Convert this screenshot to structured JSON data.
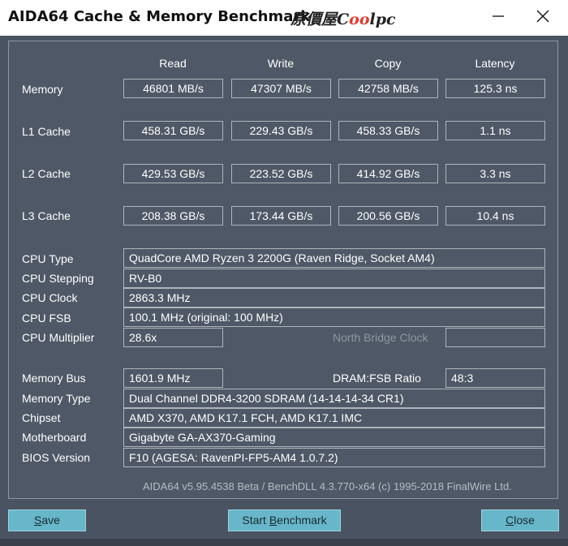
{
  "window": {
    "title": "AIDA64 Cache & Memory Benchmark",
    "logo_prefix": "原價屋C",
    "logo_o1": "o",
    "logo_o2": "o",
    "logo_suffix": "lpc",
    "logo_accent": "#e23a2c"
  },
  "columns": [
    "Read",
    "Write",
    "Copy",
    "Latency"
  ],
  "bench_rows": [
    {
      "label": "Memory",
      "values": [
        "46801 MB/s",
        "47307 MB/s",
        "42758 MB/s",
        "125.3 ns"
      ]
    },
    {
      "label": "L1 Cache",
      "values": [
        "458.31 GB/s",
        "229.43 GB/s",
        "458.33 GB/s",
        "1.1 ns"
      ]
    },
    {
      "label": "L2 Cache",
      "values": [
        "429.53 GB/s",
        "223.52 GB/s",
        "414.92 GB/s",
        "3.3 ns"
      ]
    },
    {
      "label": "L3 Cache",
      "values": [
        "208.38 GB/s",
        "173.44 GB/s",
        "200.56 GB/s",
        "10.4 ns"
      ]
    }
  ],
  "cpu": {
    "type_label": "CPU Type",
    "type": "QuadCore AMD Ryzen 3 2200G  (Raven Ridge, Socket AM4)",
    "stepping_label": "CPU Stepping",
    "stepping": "RV-B0",
    "clock_label": "CPU Clock",
    "clock": "2863.3 MHz",
    "fsb_label": "CPU FSB",
    "fsb": "100.1 MHz  (original: 100 MHz)",
    "multiplier_label": "CPU Multiplier",
    "multiplier": "28.6x",
    "nb_clock_label": "North Bridge Clock",
    "nb_clock": ""
  },
  "memory": {
    "bus_label": "Memory Bus",
    "bus": "1601.9 MHz",
    "ratio_label": "DRAM:FSB Ratio",
    "ratio": "48:3",
    "type_label": "Memory Type",
    "type": "Dual Channel DDR4-3200 SDRAM  (14-14-14-34 CR1)",
    "chipset_label": "Chipset",
    "chipset": "AMD X370, AMD K17.1 FCH, AMD K17.1 IMC",
    "motherboard_label": "Motherboard",
    "motherboard": "Gigabyte GA-AX370-Gaming",
    "bios_label": "BIOS Version",
    "bios": "F10  (AGESA: RavenPI-FP5-AM4 1.0.7.2)"
  },
  "footer": "AIDA64 v5.95.4538 Beta / BenchDLL 4.3.770-x64  (c) 1995-2018 FinalWire Ltd.",
  "buttons": {
    "save_u": "S",
    "save_rest": "ave",
    "start_pre": "Start ",
    "start_u": "B",
    "start_rest": "enchmark",
    "close_u": "C",
    "close_rest": "lose"
  },
  "colors": {
    "background": "#4a5361",
    "button": "#67b6c9",
    "dim_text": "#8f969f"
  }
}
